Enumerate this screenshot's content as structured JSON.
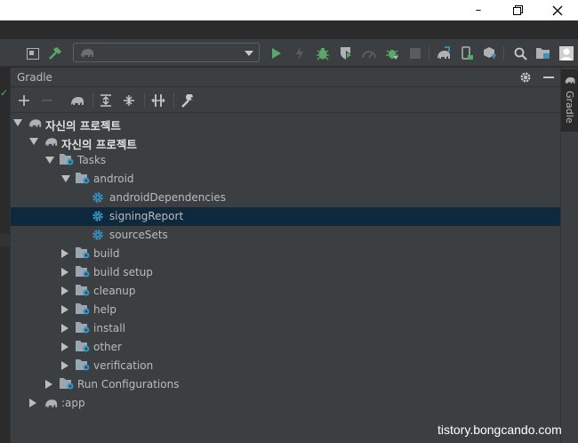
{
  "window": {
    "minimize_glyph": "–",
    "icons": [
      "minimize-icon",
      "restore-icon",
      "close-icon"
    ]
  },
  "toolbar": {
    "run_config_value": "",
    "icons": [
      "layout-icon",
      "build-hammer-icon",
      "run-config-select",
      "run-icon",
      "apply-changes-icon",
      "debug-icon",
      "profile-icon",
      "coverage-icon",
      "attach-debugger-icon",
      "stop-icon",
      "sync-gradle-icon",
      "device-manager-icon",
      "sdk-manager-icon",
      "search-icon",
      "project-structure-icon",
      "avatar"
    ]
  },
  "gradle_panel": {
    "title": "Gradle",
    "toolbar_icons": [
      "add-icon",
      "remove-icon",
      "elephant-icon",
      "expand-all-icon",
      "collapse-all-icon",
      "toggle-offline-icon",
      "settings-wrench-icon"
    ],
    "tree": [
      {
        "label": "자신의 프로젝트",
        "level": 0,
        "state": "expanded",
        "icon": "gradle-elephant-icon",
        "bold": true
      },
      {
        "label": "자신의 프로젝트",
        "level": 1,
        "state": "expanded",
        "icon": "gradle-elephant-icon",
        "bold": true
      },
      {
        "label": "Tasks",
        "level": 2,
        "state": "expanded",
        "icon": "task-folder-icon"
      },
      {
        "label": "android",
        "level": 3,
        "state": "expanded",
        "icon": "task-folder-icon"
      },
      {
        "label": "androidDependencies",
        "level": 4,
        "state": "leaf",
        "icon": "gear-task-icon"
      },
      {
        "label": "signingReport",
        "level": 4,
        "state": "leaf",
        "icon": "gear-task-icon",
        "selected": true
      },
      {
        "label": "sourceSets",
        "level": 4,
        "state": "leaf",
        "icon": "gear-task-icon"
      },
      {
        "label": "build",
        "level": 3,
        "state": "collapsed",
        "icon": "task-folder-icon"
      },
      {
        "label": "build setup",
        "level": 3,
        "state": "collapsed",
        "icon": "task-folder-icon"
      },
      {
        "label": "cleanup",
        "level": 3,
        "state": "collapsed",
        "icon": "task-folder-icon"
      },
      {
        "label": "help",
        "level": 3,
        "state": "collapsed",
        "icon": "task-folder-icon"
      },
      {
        "label": "install",
        "level": 3,
        "state": "collapsed",
        "icon": "task-folder-icon"
      },
      {
        "label": "other",
        "level": 3,
        "state": "collapsed",
        "icon": "task-folder-icon"
      },
      {
        "label": "verification",
        "level": 3,
        "state": "collapsed",
        "icon": "task-folder-icon"
      },
      {
        "label": "Run Configurations",
        "level": 2,
        "state": "collapsed",
        "icon": "task-folder-icon"
      },
      {
        "label": ":app",
        "level": 1,
        "state": "collapsed",
        "icon": "gradle-elephant-icon"
      }
    ]
  },
  "right_stripe": {
    "tab_label": "Gradle"
  },
  "watermark": "tistory.bongcando.com",
  "colors": {
    "panel_bg": "#3c3f41",
    "editor_bg": "#2b2b2b",
    "selection": "#0d293e",
    "run_green": "#59a869",
    "text": "#bbbbbb",
    "accent_blue": "#3592c4"
  }
}
